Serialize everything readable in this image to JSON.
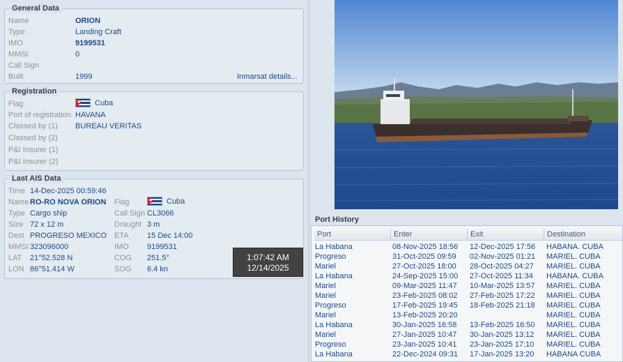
{
  "general": {
    "title": "General Data",
    "name_label": "Name",
    "name": "ORION",
    "type_label": "Type",
    "type": "Landing Craft",
    "imo_label": "IMO",
    "imo": "9199531",
    "mmsi_label": "MMSI",
    "mmsi": "0",
    "callsign_label": "Call Sign",
    "callsign": "",
    "built_label": "Built",
    "built": "1999",
    "inmarsat_link": "Inmarsat details..."
  },
  "registration": {
    "title": "Registration",
    "flag_label": "Flag",
    "flag": "Cuba",
    "port_label": "Port of registration",
    "port": "HAVANA",
    "classed1_label": "Classed by (1)",
    "classed1": "BUREAU VERITAS",
    "classed2_label": "Classed by (2)",
    "pi1_label": "P&I Insurer (1)",
    "pi2_label": "P&I Insurer (2)"
  },
  "ais": {
    "title": "Last AIS Data",
    "time_label": "Time",
    "time": "14-Dec-2025 00:59:46",
    "name_label": "Name",
    "name": "RO-RO NOVA ORION",
    "type_label": "Type",
    "type": "Cargo ship",
    "size_label": "Size",
    "size": "72 x 12 m",
    "dest_label": "Dest",
    "dest": "PROGRESO MEXICO",
    "mmsi_label": "MMSI",
    "mmsi": "323096000",
    "lat_label": "LAT",
    "lat": "21°52.528 N",
    "lon_label": "LON",
    "lon": "86°51.414 W",
    "flag_label": "Flag",
    "flag": "Cuba",
    "callsign_label": "Call Sign",
    "callsign": "CL3066",
    "draught_label": "Draught",
    "draught": "3 m",
    "eta_label": "ETA",
    "eta": "15 Dec 14:00",
    "imo_label": "IMO",
    "imo": "9199531",
    "cog_label": "COG",
    "cog": "251.5°",
    "sog_label": "SOG",
    "sog": "6.4 kn"
  },
  "clock": {
    "time": "1:07:42 AM",
    "date": "12/14/2025"
  },
  "port_history": {
    "title": "Port History",
    "columns": [
      "Port",
      "Enter",
      "Exit",
      "Destination"
    ],
    "rows": [
      [
        "La Habana",
        "08-Nov-2025 18:56",
        "12-Dec-2025 17:56",
        "HABANA. CUBA"
      ],
      [
        "Progreso",
        "31-Oct-2025 09:59",
        "02-Nov-2025 01:21",
        "MARIEL. CUBA"
      ],
      [
        "Mariel",
        "27-Oct-2025 18:00",
        "28-Oct-2025 04:27",
        "MARIEL. CUBA"
      ],
      [
        "La Habana",
        "24-Sep-2025 15:00",
        "27-Oct-2025 11:34",
        "HABANA. CUBA"
      ],
      [
        "Mariel",
        "09-Mar-2025 11:47",
        "10-Mar-2025 13:57",
        "MARIEL. CUBA"
      ],
      [
        "Mariel",
        "23-Feb-2025 08:02",
        "27-Feb-2025 17:22",
        "MARIEL. CUBA"
      ],
      [
        "Progreso",
        "17-Feb-2025 19:45",
        "18-Feb-2025 21:18",
        "MARIEL. CUBA"
      ],
      [
        "Mariel",
        "13-Feb-2025 20:20",
        "",
        "MARIEL. CUBA"
      ],
      [
        "La Habana",
        "30-Jan-2025 16:58",
        "13-Feb-2025 16:50",
        "MARIEL. CUBA"
      ],
      [
        "Mariel",
        "27-Jan-2025 10:47",
        "30-Jan-2025 13:12",
        "MARIEL. CUBA"
      ],
      [
        "Progreso",
        "23-Jan-2025 10:41",
        "23-Jan-2025 17:10",
        "MARIEL. CUBA"
      ],
      [
        "La Habana",
        "22-Dec-2024 09:31",
        "17-Jan-2025 13:20",
        "HABANA CUBA"
      ]
    ]
  }
}
